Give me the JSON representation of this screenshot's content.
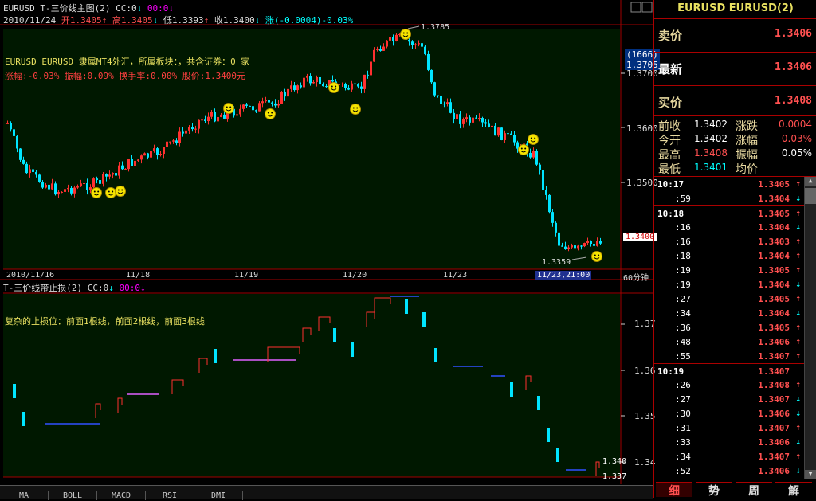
{
  "main_chart": {
    "title": "EURUSD T-三价线主图(2)",
    "cc_label": "CC:0",
    "cc_arrow": "↓",
    "cc_val2": "00:0",
    "cc_arrow2": "↓",
    "date": "2010/11/24",
    "open": "开1.3405",
    "high": "高1.3405",
    "low": "低1.3393",
    "close": "收1.3400",
    "change": "涨(-0.0004)-0.03%",
    "info_line1": "EURUSD EURUSD 隶属MT4外汇，所属板块：，共含证券：0 家",
    "info_line2": "涨幅:-0.03% 振幅:0.09% 换手率:0.00% 股价:1.3400元",
    "peak_label": "1.3785",
    "trough_label": "1.3359",
    "price_axis": {
      "ticks": [
        "1.3700",
        "1.3600",
        "1.3500"
      ],
      "badge_top": "(1666)",
      "badge_val": "1.3705",
      "current": "1.3400"
    },
    "x_labels": [
      "2010/11/16",
      "11/18",
      "11/19",
      "11/20",
      "11/23",
      "11/23,21:00"
    ],
    "period": "60分钟"
  },
  "sub_chart": {
    "title": "T-三价线带止损(2)",
    "cc_label": "CC:0",
    "cc_val2": "00:0",
    "note": "复杂的止损位：前面1根线，前面2根线，前面3根线",
    "axis_ticks": [
      "1.37",
      "1.36",
      "1.35",
      "1.34"
    ],
    "last_val1": "1.340",
    "last_val2": "1.337"
  },
  "indicator_tabs": [
    "MA",
    "BOLL",
    "MACD",
    "RSI",
    "DMI"
  ],
  "quote": {
    "symbol": "EURUSD EURUSD(2)",
    "sell_label": "卖价",
    "sell_val": "1.3406",
    "last_label": "最新",
    "last_val": "1.3406",
    "buy_label": "买价",
    "buy_val": "1.3408",
    "stats": [
      {
        "l1": "前收",
        "v1": "1.3402",
        "l2": "涨跌",
        "v2": "0.0004"
      },
      {
        "l1": "今开",
        "v1": "1.3402",
        "l2": "涨幅",
        "v2": "0.03%"
      },
      {
        "l1": "最高",
        "v1": "1.3408",
        "l2": "振幅",
        "v2": "0.05%"
      },
      {
        "l1": "最低",
        "v1": "1.3401",
        "l2": "均价",
        "v2": ""
      }
    ],
    "ticks": [
      {
        "t": "10:17",
        "p": "1.3405",
        "d": "up",
        "major": true
      },
      {
        "t": ":59",
        "p": "1.3404",
        "d": "down"
      },
      {
        "t": "10:18",
        "p": "1.3405",
        "d": "up",
        "major": true
      },
      {
        "t": ":16",
        "p": "1.3404",
        "d": "down"
      },
      {
        "t": ":16",
        "p": "1.3403",
        "d": "up"
      },
      {
        "t": ":18",
        "p": "1.3404",
        "d": "up"
      },
      {
        "t": ":19",
        "p": "1.3405",
        "d": "up"
      },
      {
        "t": ":19",
        "p": "1.3404",
        "d": "down"
      },
      {
        "t": ":27",
        "p": "1.3405",
        "d": "up"
      },
      {
        "t": ":34",
        "p": "1.3404",
        "d": "down"
      },
      {
        "t": ":36",
        "p": "1.3405",
        "d": "up"
      },
      {
        "t": ":48",
        "p": "1.3406",
        "d": "up"
      },
      {
        "t": ":55",
        "p": "1.3407",
        "d": "up"
      },
      {
        "t": "10:19",
        "p": "1.3407",
        "d": "",
        "major": true
      },
      {
        "t": ":26",
        "p": "1.3408",
        "d": "up"
      },
      {
        "t": ":27",
        "p": "1.3407",
        "d": "down"
      },
      {
        "t": ":30",
        "p": "1.3406",
        "d": "down"
      },
      {
        "t": ":31",
        "p": "1.3407",
        "d": "up"
      },
      {
        "t": ":33",
        "p": "1.3406",
        "d": "down"
      },
      {
        "t": ":34",
        "p": "1.3407",
        "d": "up"
      },
      {
        "t": ":52",
        "p": "1.3406",
        "d": "down"
      }
    ],
    "bottom_tabs": [
      "细",
      "势",
      "周",
      "解"
    ]
  },
  "colors": {
    "up": "#ff3030",
    "down": "#00e5ff",
    "grid": "#a00000",
    "bg": "#001800"
  }
}
